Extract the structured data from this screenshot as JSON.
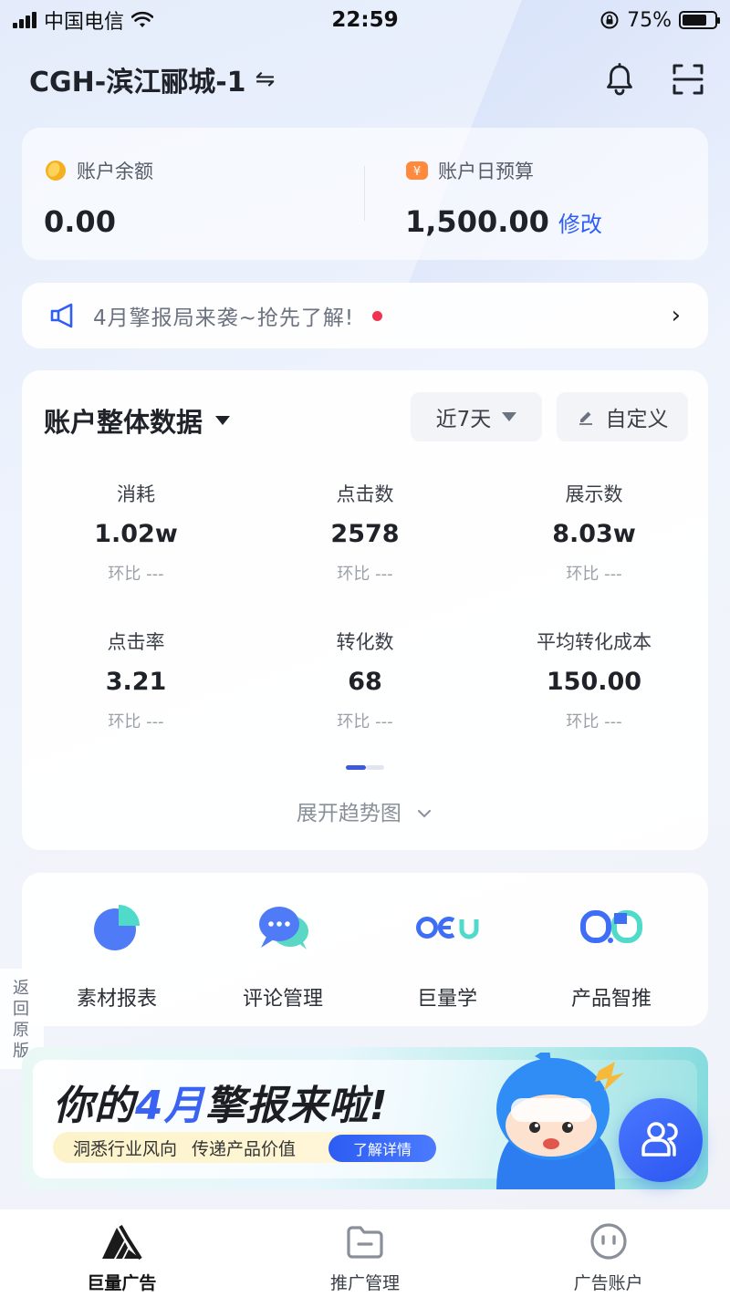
{
  "status_bar": {
    "carrier": "中国电信",
    "time": "22:59",
    "battery": "75%",
    "battery_level": 0.75
  },
  "header": {
    "account_name": "CGH-滨江郦城-1",
    "swap_symbol": "⇋",
    "icons": [
      "bell-icon",
      "scan-icon"
    ]
  },
  "balance": {
    "balance_label": "账户余额",
    "balance_value": "0.00",
    "budget_label": "账户日预算",
    "budget_value": "1,500.00",
    "edit_label": "修改"
  },
  "notice": {
    "text": "4月擎报局来袭~抢先了解!",
    "arrow": "›"
  },
  "overview": {
    "title": "账户整体数据",
    "range_label": "近7天",
    "custom_label": "自定义",
    "expand_label": "展开趋势图",
    "metrics": [
      {
        "label": "消耗",
        "value": "1.02w",
        "compare": "环比 ---"
      },
      {
        "label": "点击数",
        "value": "2578",
        "compare": "环比 ---"
      },
      {
        "label": "展示数",
        "value": "8.03w",
        "compare": "环比 ---"
      },
      {
        "label": "点击率",
        "value": "3.21",
        "compare": "环比 ---"
      },
      {
        "label": "转化数",
        "value": "68",
        "compare": "环比 ---"
      },
      {
        "label": "平均转化成本",
        "value": "150.00",
        "compare": "环比 ---"
      }
    ]
  },
  "tools": [
    {
      "label": "素材报表",
      "icon": "pie-chart-icon"
    },
    {
      "label": "评论管理",
      "icon": "chat-bubble-icon"
    },
    {
      "label": "巨量学",
      "icon": "oceanengine-learn-icon"
    },
    {
      "label": "产品智推",
      "icon": "smart-push-icon"
    }
  ],
  "back_tab": {
    "label": "返回原版"
  },
  "banner": {
    "title_prefix": "你的",
    "title_highlight": "4月",
    "title_suffix": "擎报来啦!",
    "sub_1": "洞悉行业风向",
    "sub_2": "传递产品价值",
    "button": "了解详情"
  },
  "tabbar": [
    {
      "label": "巨量广告",
      "icon": "oceanengine-logo-icon",
      "active": true
    },
    {
      "label": "推广管理",
      "icon": "folder-icon",
      "active": false
    },
    {
      "label": "广告账户",
      "icon": "account-face-icon",
      "active": false
    }
  ],
  "colors": {
    "accent": "#2f5ef5",
    "notice_dot": "#f0334f",
    "text_primary": "#1f2329",
    "text_secondary": "#9aa0a8"
  }
}
